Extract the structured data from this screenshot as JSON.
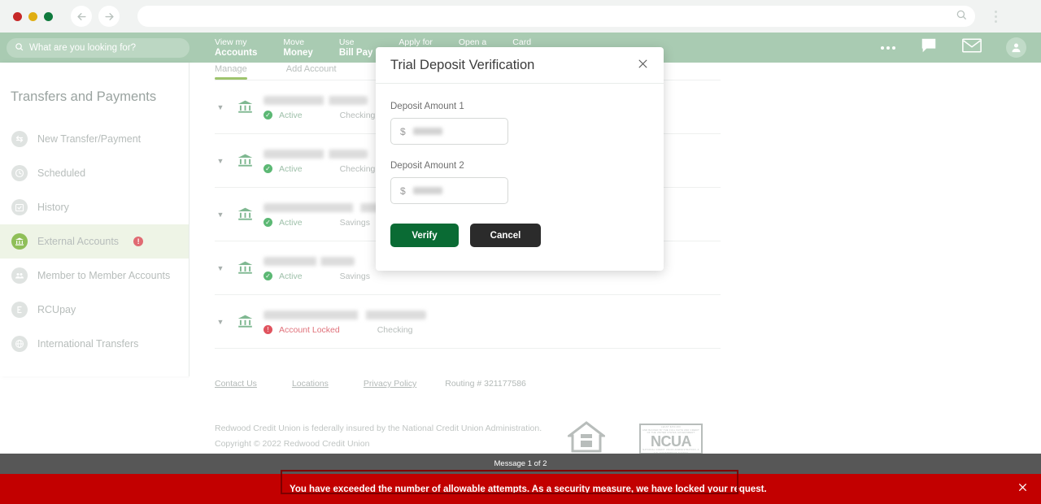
{
  "browser": {
    "traffic_lights": [
      "close",
      "minimize",
      "zoom"
    ],
    "back_icon": "back-arrow-icon",
    "forward_icon": "forward-arrow-icon",
    "url_value": "",
    "url_search_icon": "search-icon",
    "menu_icon": "kebab-menu-icon"
  },
  "appnav": {
    "search_placeholder": "What are you looking for?",
    "search_icon": "search-icon",
    "items": [
      {
        "line1": "View my",
        "line2": "Accounts"
      },
      {
        "line1": "Move",
        "line2": "Money"
      },
      {
        "line1": "Use",
        "line2": "Bill Pay"
      },
      {
        "line1": "Apply for",
        "line2": ""
      },
      {
        "line1": "Open a",
        "line2": ""
      },
      {
        "line1": "Card",
        "line2": ""
      }
    ],
    "more_icon": "more-dots-icon",
    "chat_icon": "chat-bubble-icon",
    "mail_icon": "envelope-icon",
    "avatar_icon": "user-avatar-icon"
  },
  "sidebar": {
    "title": "Transfers and Payments",
    "items": [
      {
        "label": "New Transfer/Payment",
        "icon": "transfer-icon",
        "active": false,
        "badge": ""
      },
      {
        "label": "Scheduled",
        "icon": "clock-icon",
        "active": false,
        "badge": ""
      },
      {
        "label": "History",
        "icon": "calendar-check-icon",
        "active": false,
        "badge": ""
      },
      {
        "label": "External Accounts",
        "icon": "bank-icon",
        "active": true,
        "badge": "!"
      },
      {
        "label": "Member to Member Accounts",
        "icon": "people-icon",
        "active": false,
        "badge": ""
      },
      {
        "label": "RCUpay",
        "icon": "rcupay-icon",
        "active": false,
        "badge": ""
      },
      {
        "label": "International Transfers",
        "icon": "globe-icon",
        "active": false,
        "badge": ""
      }
    ]
  },
  "main": {
    "tabs": [
      {
        "label": "Manage",
        "active": true
      },
      {
        "label": "Add Account",
        "active": false
      }
    ],
    "accounts": [
      {
        "name_redacted": true,
        "status": "Active",
        "status_type": "ok",
        "type": "Checking"
      },
      {
        "name_redacted": true,
        "status": "Active",
        "status_type": "ok",
        "type": "Checking"
      },
      {
        "name_redacted": true,
        "status": "Active",
        "status_type": "ok",
        "type": "Savings"
      },
      {
        "name_redacted": true,
        "status": "Active",
        "status_type": "ok",
        "type": "Savings"
      },
      {
        "name_redacted": true,
        "status": "Account Locked",
        "status_type": "locked",
        "type": "Checking"
      }
    ]
  },
  "footer": {
    "links": [
      "Contact Us",
      "Locations",
      "Privacy Policy"
    ],
    "routing": "Routing # 321177586",
    "insured_note": "Redwood Credit Union is federally insured by the National Credit Union Administration.",
    "copyright": "Copyright © 2022 Redwood Credit Union",
    "housing_icon": "equal-housing-lender-icon",
    "ncua": {
      "top_line": "YOUR SAVINGS FEDERALLY INSURED TO AT LEAST $250,000",
      "mid_line": "AND BACKED BY THE FULL FAITH AND CREDIT OF THE UNITED STATES GOVERNMENT",
      "word": "NCUA",
      "bottom_line": "NATIONAL CREDIT UNION ADMINISTRATION, A U.S. GOVERNMENT AGENCY"
    }
  },
  "modal": {
    "title": "Trial Deposit Verification",
    "close_icon": "close-icon",
    "fields": [
      {
        "label": "Deposit Amount 1",
        "prefix": "$",
        "value_masked": true
      },
      {
        "label": "Deposit Amount 2",
        "prefix": "$",
        "value_masked": true
      }
    ],
    "verify_label": "Verify",
    "cancel_label": "Cancel"
  },
  "message_bar": {
    "counter": "Message 1 of 2",
    "text": "You have exceeded the number of allowable attempts. As a security measure, we have locked your request.",
    "close_icon": "close-icon"
  },
  "colors": {
    "nav_green": "#a9cbb2",
    "accent_green": "#8fbf58",
    "verify_green": "#0a6b34",
    "cancel_dark": "#2b2b2b",
    "error_red": "#c20000",
    "counter_gray": "#575757"
  }
}
